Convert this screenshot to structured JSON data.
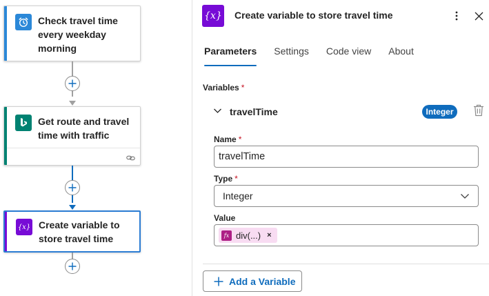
{
  "flow": {
    "steps": [
      {
        "title": "Check travel time every weekday morning",
        "icon": "alarm-clock-icon",
        "color": "#2b88d8"
      },
      {
        "title": "Get route and travel time with traffic",
        "icon": "bing-maps-icon",
        "color": "#008272"
      },
      {
        "title": "Create variable to store travel time",
        "icon": "variable-icon",
        "color": "#770bd6"
      }
    ],
    "connector_color_default": "#a0a0a0",
    "connector_color_active": "#0f6cbd"
  },
  "panel": {
    "title": "Create variable to store travel time",
    "header_icon_glyph": "{x}",
    "tabs": [
      {
        "label": "Parameters",
        "active": true
      },
      {
        "label": "Settings",
        "active": false
      },
      {
        "label": "Code view",
        "active": false
      },
      {
        "label": "About",
        "active": false
      }
    ],
    "variables_label": "Variables",
    "required_mark": "*",
    "variable": {
      "name": "travelTime",
      "type_badge": "Integer",
      "name_label": "Name",
      "name_value": "travelTime",
      "type_label": "Type",
      "type_value": "Integer",
      "value_label": "Value",
      "value_token": "div(...)",
      "token_icon_glyph": "fx",
      "token_remove_glyph": "×"
    },
    "add_button_label": "Add a Variable"
  },
  "colors": {
    "accent": "#0f6cbd",
    "variable_purple": "#770bd6",
    "token_bg": "#f8dcf2",
    "token_icon": "#ad1f85"
  }
}
